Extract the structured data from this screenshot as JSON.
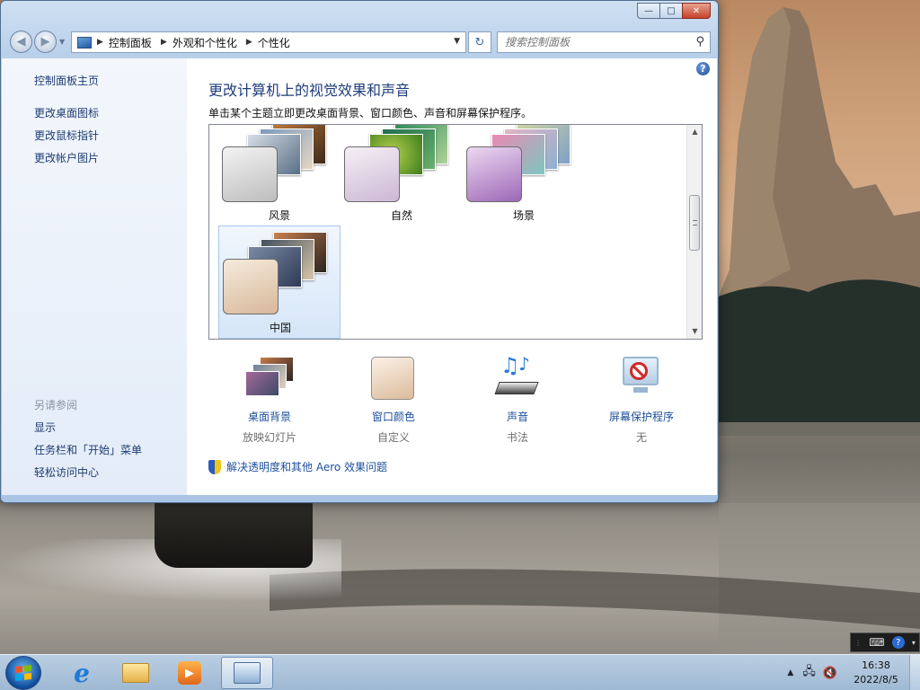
{
  "window": {
    "caption_buttons": {
      "minimize": "—",
      "maximize": "□",
      "close": "✕"
    },
    "nav": {
      "back": "◀",
      "forward": "▶",
      "recent": "▼",
      "refresh": "↻"
    },
    "breadcrumbs": [
      "控制面板",
      "外观和个性化",
      "个性化"
    ],
    "breadcrumb_sep": "▶",
    "search": {
      "placeholder": "搜索控制面板",
      "icon": "search-icon"
    }
  },
  "sidebar": {
    "home": "控制面板主页",
    "links": [
      "更改桌面图标",
      "更改鼠标指针",
      "更改帐户图片"
    ],
    "see_also_heading": "另请参阅",
    "see_also": [
      "显示",
      "任务栏和「开始」菜单",
      "轻松访问中心"
    ]
  },
  "main": {
    "help": "?",
    "title": "更改计算机上的视觉效果和声音",
    "description": "单击某个主题立即更改桌面背景、窗口颜色、声音和屏幕保护程序。",
    "themes": [
      {
        "name": "风景",
        "selected": false
      },
      {
        "name": "自然",
        "selected": false
      },
      {
        "name": "场景",
        "selected": false
      },
      {
        "name": "中国",
        "selected": true
      }
    ],
    "scrollbar": {
      "up": "▲",
      "down": "▼"
    },
    "settings": [
      {
        "label": "桌面背景",
        "value": "放映幻灯片",
        "icon": "desktop-background-icon"
      },
      {
        "label": "窗口颜色",
        "value": "自定义",
        "icon": "window-color-icon"
      },
      {
        "label": "声音",
        "value": "书法",
        "icon": "sounds-icon"
      },
      {
        "label": "屏幕保护程序",
        "value": "无",
        "icon": "screensaver-icon"
      }
    ],
    "aero_link": "解决透明度和其他 Aero 效果问题"
  },
  "taskbar": {
    "clock_time": "16:38",
    "clock_date": "2022/8/5",
    "pinned": [
      "internet-explorer-icon",
      "windows-explorer-icon",
      "media-player-icon",
      "control-panel-icon"
    ],
    "tray_icons": [
      "show-hidden-icons",
      "network-icon",
      "volume-muted-icon"
    ]
  },
  "colors": {
    "accent_link": "#1e4f9c",
    "title_blue": "#1e3d7a",
    "close_red": "#c7412a"
  }
}
